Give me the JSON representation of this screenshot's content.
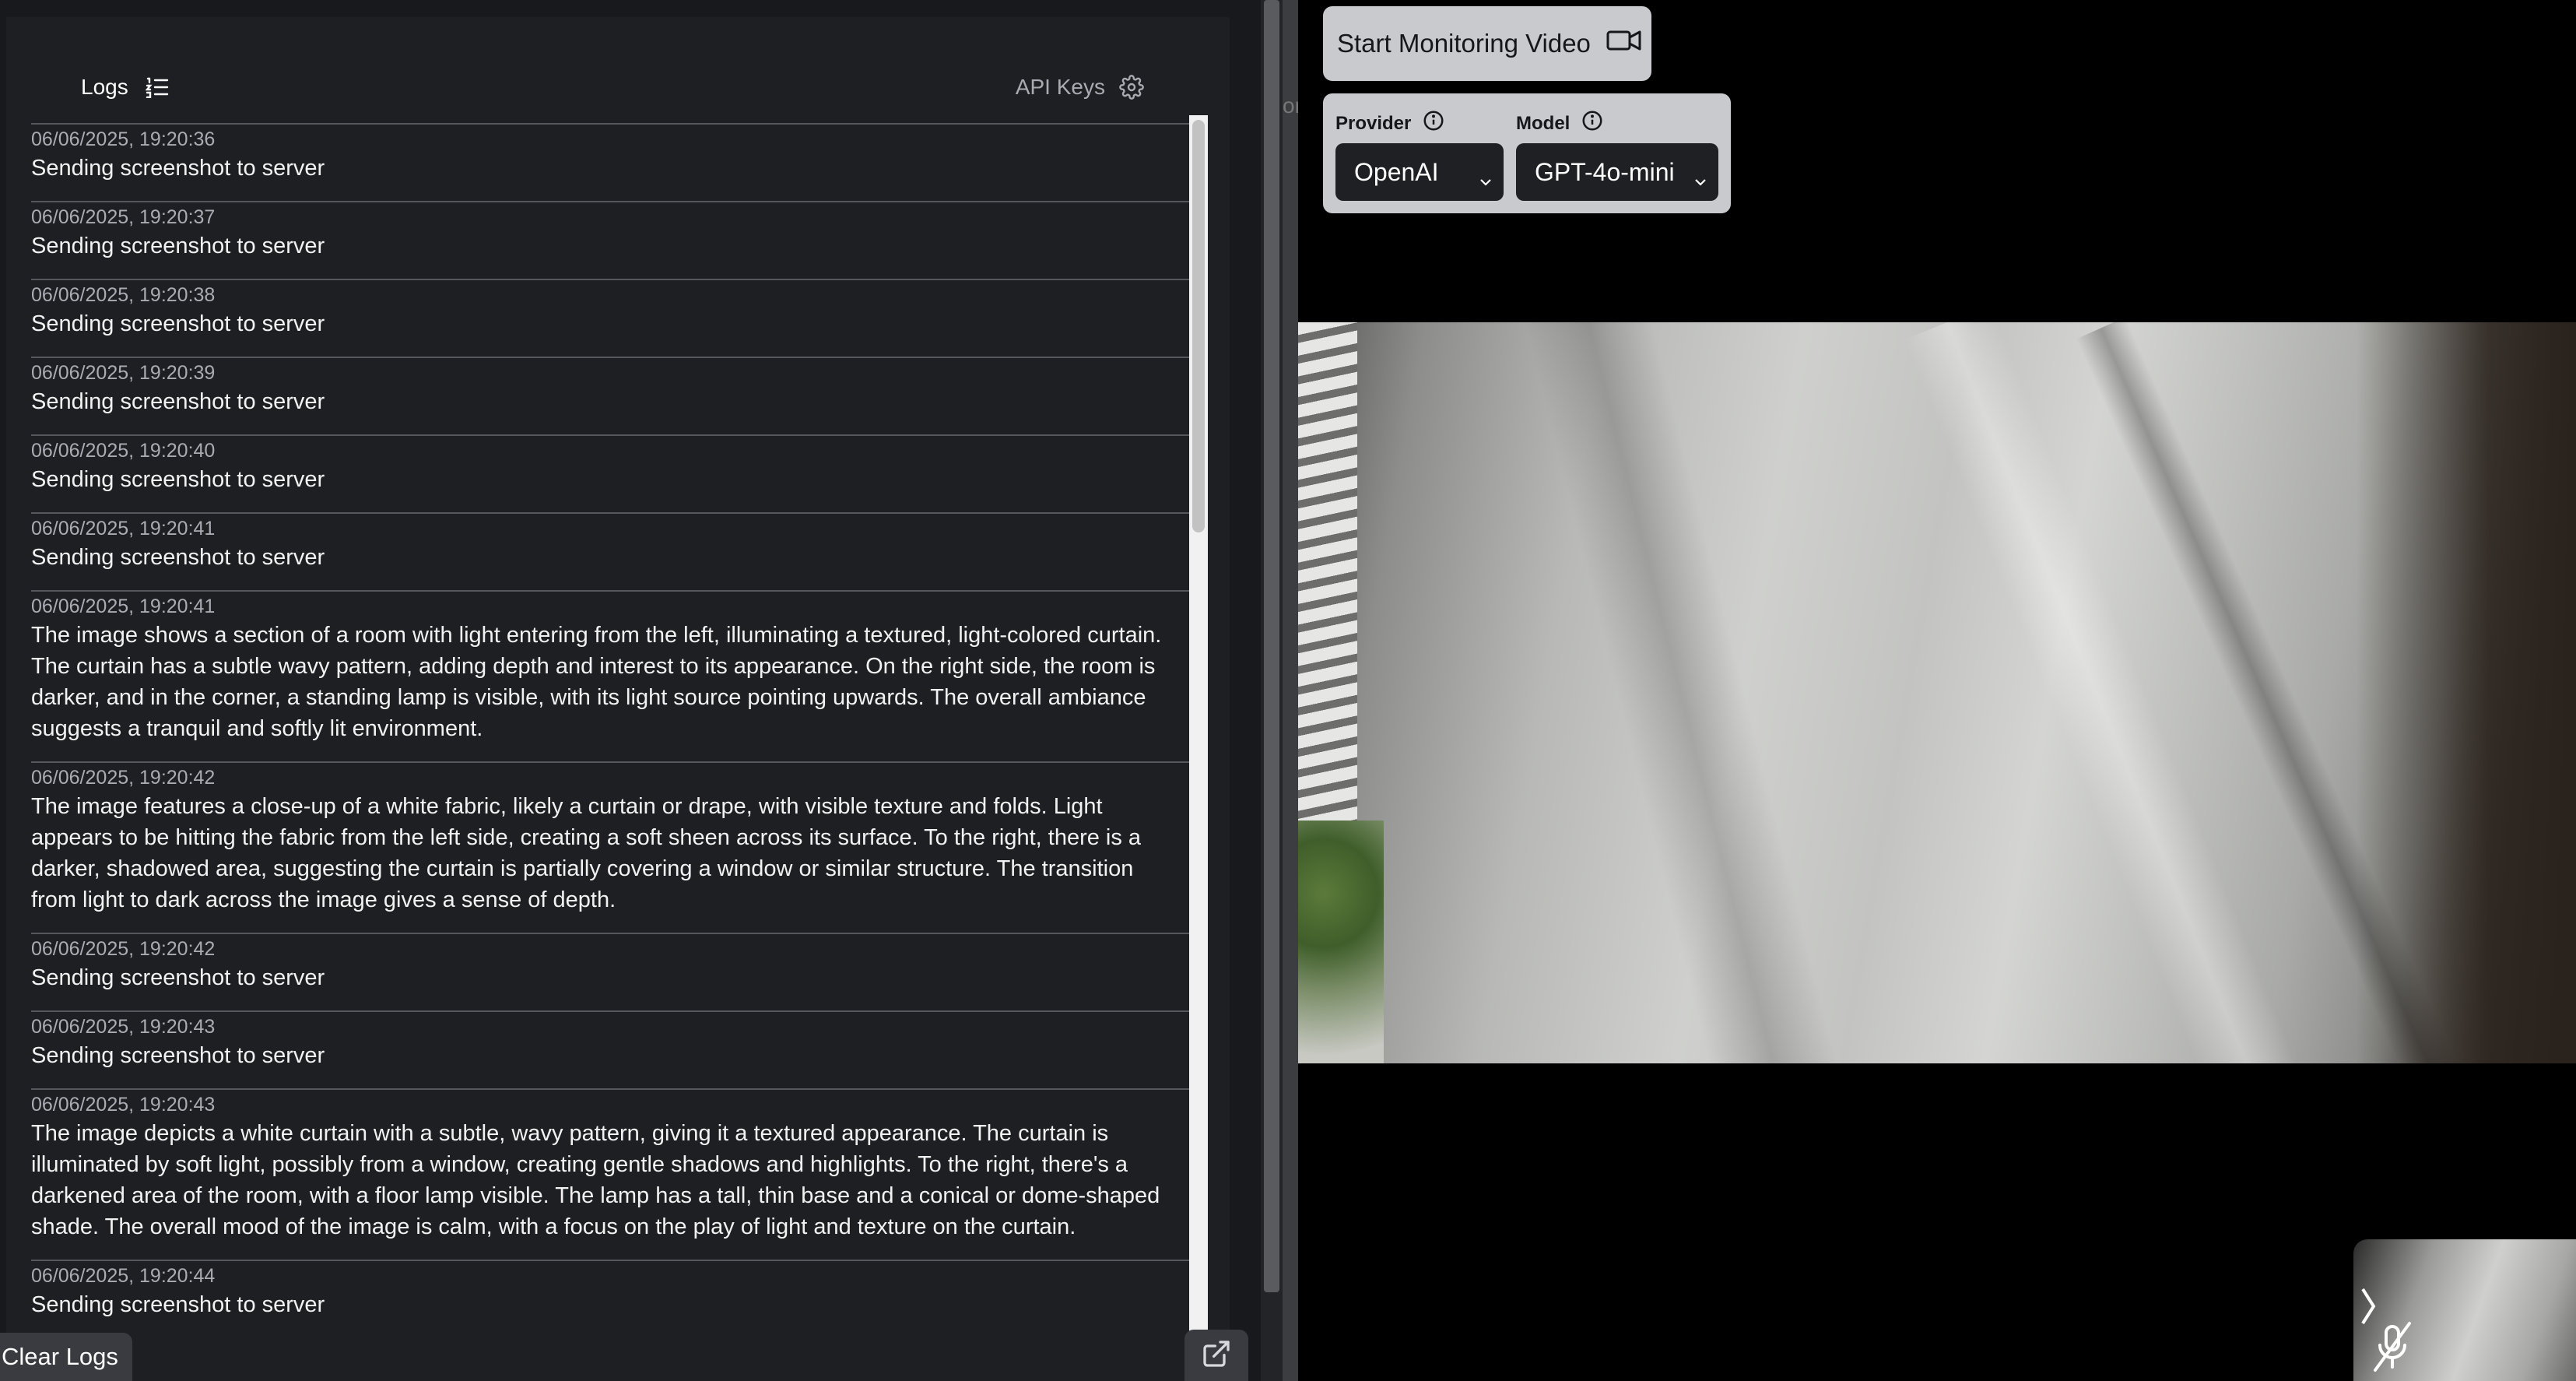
{
  "left_panel": {
    "tabs": {
      "logs_label": "Logs",
      "logs_icon": "list-ordered-icon",
      "api_keys_label": "API Keys",
      "api_keys_icon": "gear-icon"
    },
    "log_entries": [
      {
        "time": "06/06/2025, 19:20:36",
        "message": "Sending screenshot to server"
      },
      {
        "time": "06/06/2025, 19:20:37",
        "message": "Sending screenshot to server"
      },
      {
        "time": "06/06/2025, 19:20:38",
        "message": "Sending screenshot to server"
      },
      {
        "time": "06/06/2025, 19:20:39",
        "message": "Sending screenshot to server"
      },
      {
        "time": "06/06/2025, 19:20:40",
        "message": "Sending screenshot to server"
      },
      {
        "time": "06/06/2025, 19:20:41",
        "message": "Sending screenshot to server"
      },
      {
        "time": "06/06/2025, 19:20:41",
        "message": "The image shows a section of a room with light entering from the left, illuminating a textured, light-colored curtain. The curtain has a subtle wavy pattern, adding depth and interest to its appearance. On the right side, the room is darker, and in the corner, a standing lamp is visible, with its light source pointing upwards. The overall ambiance suggests a tranquil and softly lit environment."
      },
      {
        "time": "06/06/2025, 19:20:42",
        "message": "The image features a close-up of a white fabric, likely a curtain or drape, with visible texture and folds. Light appears to be hitting the fabric from the left side, creating a soft sheen across its surface. To the right, there is a darker, shadowed area, suggesting the curtain is partially covering a window or similar structure. The transition from light to dark across the image gives a sense of depth."
      },
      {
        "time": "06/06/2025, 19:20:42",
        "message": "Sending screenshot to server"
      },
      {
        "time": "06/06/2025, 19:20:43",
        "message": "Sending screenshot to server"
      },
      {
        "time": "06/06/2025, 19:20:43",
        "message": "The image depicts a white curtain with a subtle, wavy pattern, giving it a textured appearance. The curtain is illuminated by soft light, possibly from a window, creating gentle shadows and highlights. To the right, there's a darkened area of the room, with a floor lamp visible. The lamp has a tall, thin base and a conical or dome-shaped shade. The overall mood of the image is calm, with a focus on the play of light and texture on the curtain."
      },
      {
        "time": "06/06/2025, 19:20:44",
        "message": "Sending screenshot to server"
      }
    ],
    "clear_logs_label": "Clear Logs",
    "popout_icon": "external-link-icon"
  },
  "divider": {
    "peek_text": "or"
  },
  "controls": {
    "start_button_label": "Start Monitoring Video",
    "start_button_icon": "video-camera-icon",
    "provider_label": "Provider",
    "provider_value": "OpenAI",
    "model_label": "Model",
    "model_value": "GPT-4o-mini",
    "info_icon": "info-icon",
    "chevron_icon": "chevron-down-icon"
  },
  "preview": {
    "expand_icon": "chevron-right-icon",
    "mic_icon": "microphone-off-icon"
  },
  "colors": {
    "panel_bg": "#1e1f23",
    "card_bg": "#c9cacd",
    "select_bg": "#1f2024"
  }
}
